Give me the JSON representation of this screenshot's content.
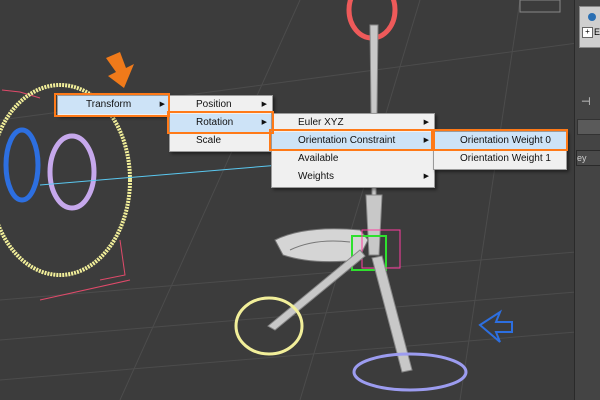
{
  "menu_l1": {
    "items": [
      {
        "label": "Transform",
        "has_submenu": true
      }
    ]
  },
  "menu_l2": {
    "items": [
      {
        "label": "Position",
        "has_submenu": true
      },
      {
        "label": "Rotation",
        "has_submenu": true
      },
      {
        "label": "Scale",
        "has_submenu": false
      }
    ]
  },
  "menu_l3": {
    "items": [
      {
        "label": "Euler XYZ",
        "has_submenu": true
      },
      {
        "label": "Orientation Constraint",
        "has_submenu": true
      },
      {
        "label": "Available",
        "has_submenu": false
      },
      {
        "label": "Weights",
        "has_submenu": true
      }
    ]
  },
  "menu_l4": {
    "items": [
      {
        "label": "Orientation Weight 0",
        "has_submenu": false
      },
      {
        "label": "Orientation Weight 1",
        "has_submenu": false
      }
    ]
  },
  "side_panel": {
    "letter": "E",
    "pin_icon": "pin-icon",
    "truncated_text": "ey"
  },
  "submenu_arrow_glyph": "▶",
  "colors": {
    "highlight_ring": "#ff7a18",
    "menu_bg": "#f0f0f0",
    "menu_hover": "#cde3f7",
    "viewport_bg": "#3c3c3c",
    "pointer_arrow": "#f07a1a",
    "control_yellow": "#f2ef9a",
    "control_blue": "#2d6fe0",
    "control_purple": "#c6a8ec",
    "control_red": "#ee5a5a",
    "control_lavender": "#9c9cf0",
    "bone_gray": "#c8c8c8",
    "helper_green": "#2ee02e",
    "helper_pink": "#ff3da0"
  }
}
